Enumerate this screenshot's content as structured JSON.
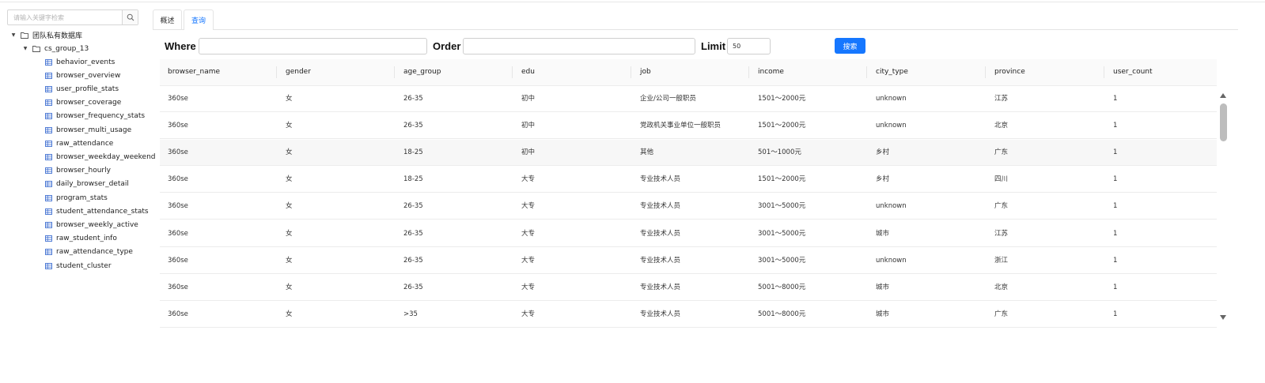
{
  "sidebar": {
    "search_placeholder": "请输入关键字检索",
    "root": "团队私有数据库",
    "group": "cs_group_13",
    "tables": [
      "behavior_events",
      "browser_overview",
      "user_profile_stats",
      "browser_coverage",
      "browser_frequency_stats",
      "browser_multi_usage",
      "raw_attendance",
      "browser_weekday_weekend",
      "browser_hourly",
      "daily_browser_detail",
      "program_stats",
      "student_attendance_stats",
      "browser_weekly_active",
      "raw_student_info",
      "raw_attendance_type",
      "student_cluster"
    ]
  },
  "tabs": [
    "概述",
    "查询"
  ],
  "active_tab": "查询",
  "query": {
    "where_label": "Where",
    "where_value": "",
    "order_label": "Order",
    "order_value": "",
    "limit_label": "Limit",
    "limit_value": "50",
    "search_button": "搜索"
  },
  "table": {
    "columns": [
      "browser_name",
      "gender",
      "age_group",
      "edu",
      "job",
      "income",
      "city_type",
      "province",
      "user_count"
    ],
    "rows": [
      [
        "360se",
        "女",
        "26-35",
        "初中",
        "企业/公司一般职员",
        "1501～2000元",
        "unknown",
        "江苏",
        "1"
      ],
      [
        "360se",
        "女",
        "26-35",
        "初中",
        "党政机关事业单位一般职员",
        "1501～2000元",
        "unknown",
        "北京",
        "1"
      ],
      [
        "360se",
        "女",
        "18-25",
        "初中",
        "其他",
        "501～1000元",
        "乡村",
        "广东",
        "1"
      ],
      [
        "360se",
        "女",
        "18-25",
        "大专",
        "专业技术人员",
        "1501～2000元",
        "乡村",
        "四川",
        "1"
      ],
      [
        "360se",
        "女",
        "26-35",
        "大专",
        "专业技术人员",
        "3001～5000元",
        "unknown",
        "广东",
        "1"
      ],
      [
        "360se",
        "女",
        "26-35",
        "大专",
        "专业技术人员",
        "3001～5000元",
        "城市",
        "江苏",
        "1"
      ],
      [
        "360se",
        "女",
        "26-35",
        "大专",
        "专业技术人员",
        "3001～5000元",
        "unknown",
        "浙江",
        "1"
      ],
      [
        "360se",
        "女",
        "26-35",
        "大专",
        "专业技术人员",
        "5001～8000元",
        "城市",
        "北京",
        "1"
      ],
      [
        "360se",
        "女",
        ">35",
        "大专",
        "专业技术人员",
        "5001～8000元",
        "城市",
        "广东",
        "1"
      ]
    ]
  },
  "colors": {
    "accent": "#1677ff",
    "header_bg": "#fafafa",
    "hover_row": "#f7f7f7"
  }
}
